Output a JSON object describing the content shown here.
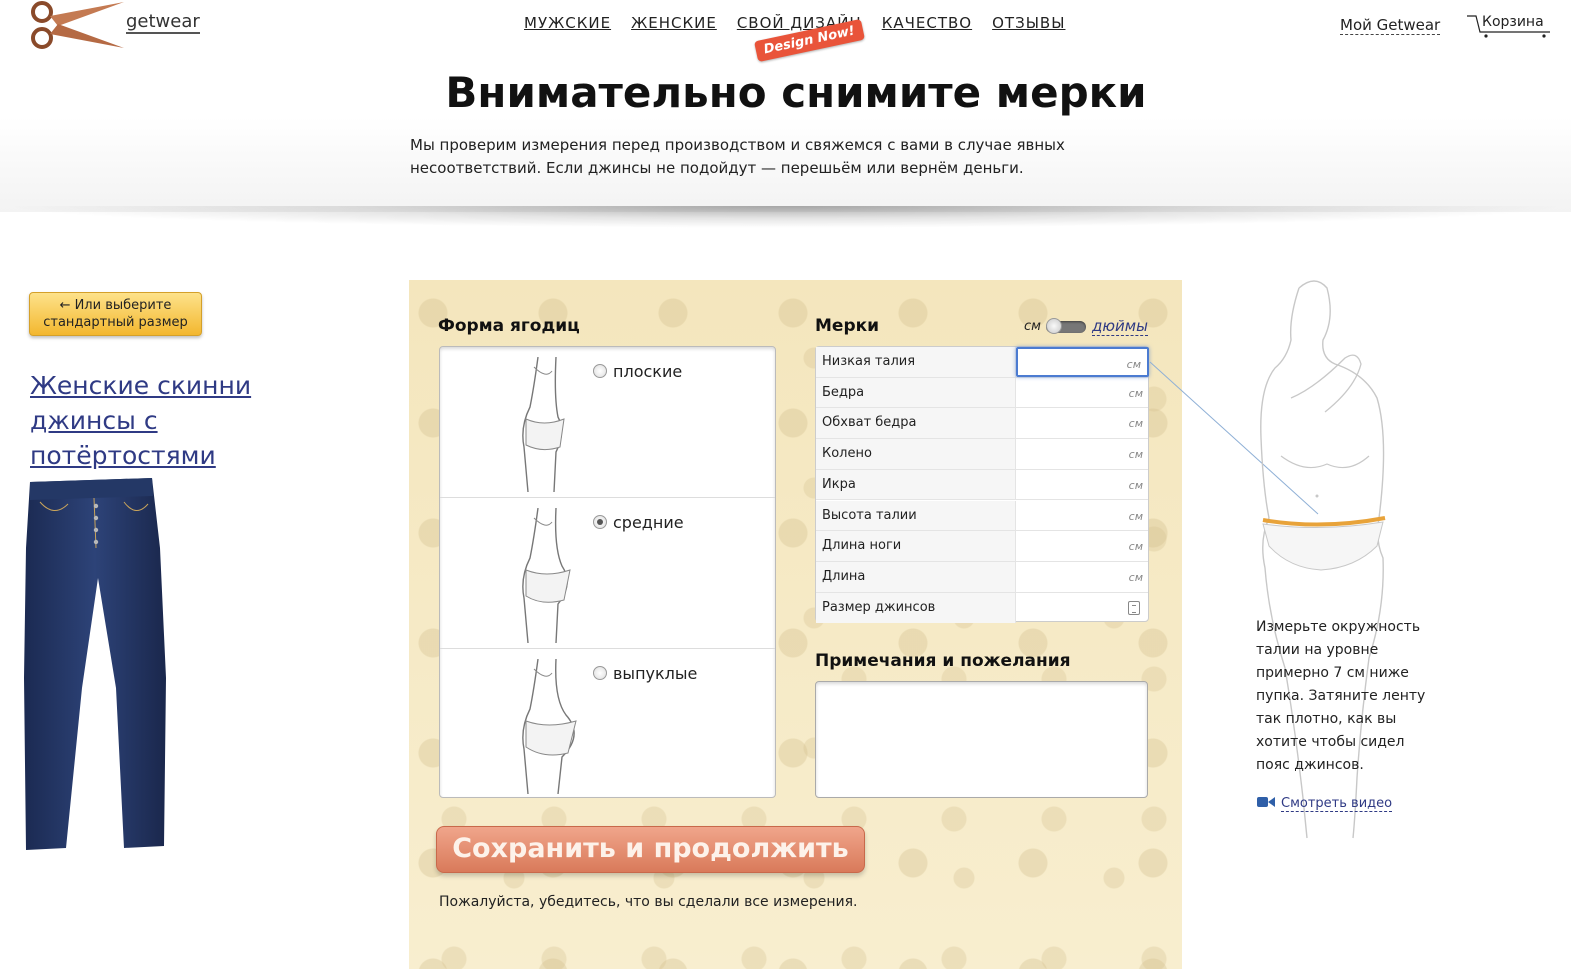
{
  "header": {
    "logo_text": "getwear",
    "nav": [
      "МУЖСКИЕ",
      "ЖЕНСКИЕ",
      "СВОЙ ДИЗАЙН",
      "КАЧЕСТВО",
      "ОТЗЫВЫ"
    ],
    "design_badge": "Design Now!",
    "account_link": "Мой Getwear",
    "cart_label": "Корзина"
  },
  "page": {
    "title": "Внимательно снимите мерки",
    "intro": "Мы проверим измерения перед производством и свяжемся с вами в случае явных несоответствий. Если джинсы не подойдут — перешьём или вернём деньги."
  },
  "left": {
    "std_size_button": "← Или выберите стандартный размер",
    "product_title": "Женские скинни джинсы с потёртостями"
  },
  "form": {
    "buttock_shape_title": "Форма ягодиц",
    "shapes": [
      {
        "label": "плоские",
        "selected": false
      },
      {
        "label": "средние",
        "selected": true
      },
      {
        "label": "выпуклые",
        "selected": false
      }
    ],
    "measurements_title": "Мерки",
    "unit_cm": "см",
    "unit_inches": "дюймы",
    "measurements": [
      {
        "label": "Низкая талия",
        "unit": "см",
        "value": ""
      },
      {
        "label": "Бедра",
        "unit": "см",
        "value": ""
      },
      {
        "label": "Обхват бедра",
        "unit": "см",
        "value": ""
      },
      {
        "label": "Колено",
        "unit": "см",
        "value": ""
      },
      {
        "label": "Икра",
        "unit": "см",
        "value": ""
      },
      {
        "label": "Высота талии",
        "unit": "см",
        "value": ""
      },
      {
        "label": "Длина ноги",
        "unit": "см",
        "value": ""
      },
      {
        "label": "Длина",
        "unit": "см",
        "value": ""
      },
      {
        "label": "Размер джинсов",
        "unit": "",
        "value": ""
      }
    ],
    "notes_title": "Примечания и пожелания",
    "notes_value": "",
    "save_button": "Сохранить и продолжить",
    "hint": "Пожалуйста, убедитесь, что вы сделали все измерения."
  },
  "guide": {
    "instruction": "Измерьте окружность талии на уровне примерно 7 см ниже пупка. Затяните ленту так плотно, как вы хотите чтобы сидел пояс джинсов.",
    "video_link": "Смотреть видео",
    "accent_color": "#e8a33a"
  }
}
